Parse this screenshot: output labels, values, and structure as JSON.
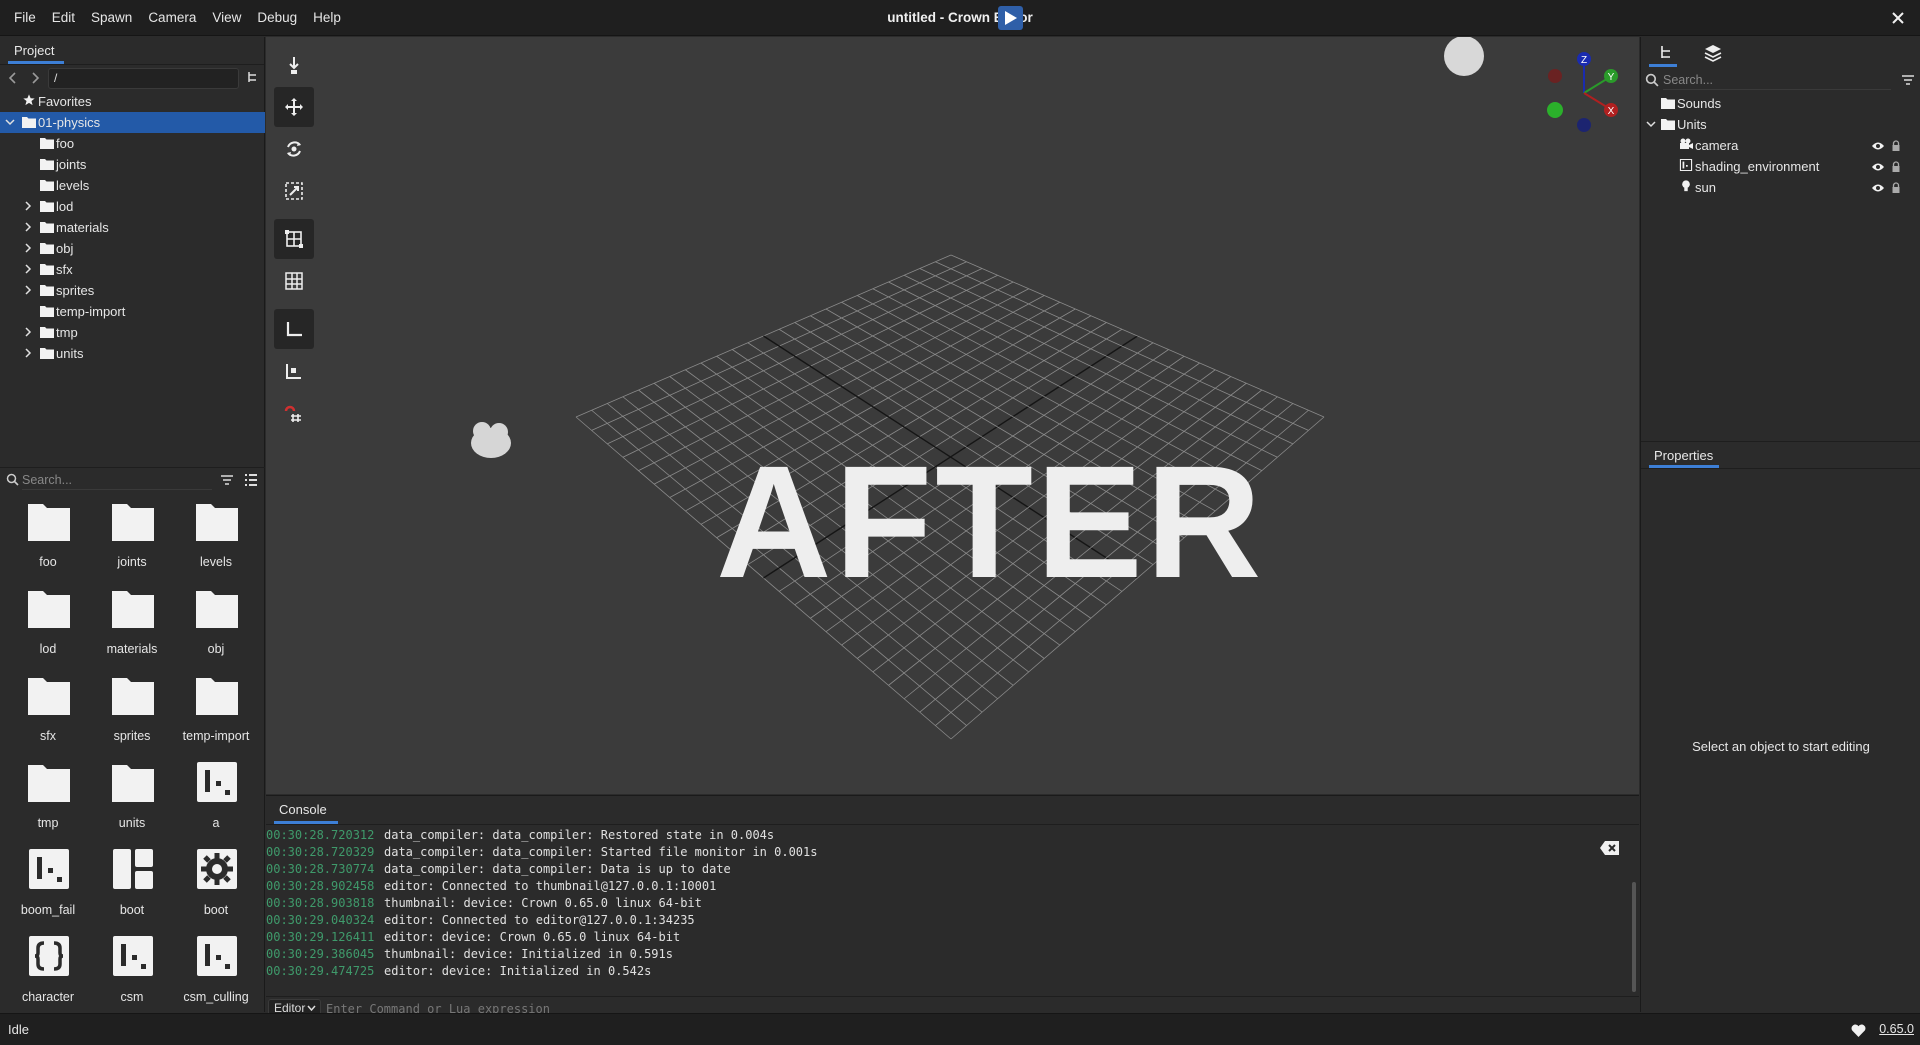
{
  "window": {
    "title": "untitled - Crown Editor",
    "menus": [
      "File",
      "Edit",
      "Spawn",
      "Camera",
      "View",
      "Debug",
      "Help"
    ]
  },
  "project": {
    "tab": "Project",
    "path": "/",
    "tree": [
      {
        "label": "Favorites",
        "icon": "star-icon",
        "depth": 0,
        "expander": "none"
      },
      {
        "label": "01-physics",
        "icon": "folder-icon",
        "depth": 0,
        "expander": "open",
        "selected": true
      },
      {
        "label": "foo",
        "icon": "folder-icon",
        "depth": 1,
        "expander": "none"
      },
      {
        "label": "joints",
        "icon": "folder-icon",
        "depth": 1,
        "expander": "none"
      },
      {
        "label": "levels",
        "icon": "folder-icon",
        "depth": 1,
        "expander": "none"
      },
      {
        "label": "lod",
        "icon": "folder-icon",
        "depth": 1,
        "expander": "closed"
      },
      {
        "label": "materials",
        "icon": "folder-icon",
        "depth": 1,
        "expander": "closed"
      },
      {
        "label": "obj",
        "icon": "folder-icon",
        "depth": 1,
        "expander": "closed"
      },
      {
        "label": "sfx",
        "icon": "folder-icon",
        "depth": 1,
        "expander": "closed"
      },
      {
        "label": "sprites",
        "icon": "folder-icon",
        "depth": 1,
        "expander": "closed"
      },
      {
        "label": "temp-import",
        "icon": "folder-icon",
        "depth": 1,
        "expander": "none"
      },
      {
        "label": "tmp",
        "icon": "folder-icon",
        "depth": 1,
        "expander": "closed"
      },
      {
        "label": "units",
        "icon": "folder-icon",
        "depth": 1,
        "expander": "closed"
      }
    ],
    "search_placeholder": "Search...",
    "items": [
      {
        "label": "foo",
        "icon": "folder-icon"
      },
      {
        "label": "joints",
        "icon": "folder-icon"
      },
      {
        "label": "levels",
        "icon": "folder-icon"
      },
      {
        "label": "lod",
        "icon": "folder-icon"
      },
      {
        "label": "materials",
        "icon": "folder-icon"
      },
      {
        "label": "obj",
        "icon": "folder-icon"
      },
      {
        "label": "sfx",
        "icon": "folder-icon"
      },
      {
        "label": "sprites",
        "icon": "folder-icon"
      },
      {
        "label": "temp-import",
        "icon": "folder-icon"
      },
      {
        "label": "tmp",
        "icon": "folder-icon"
      },
      {
        "label": "units",
        "icon": "folder-icon"
      },
      {
        "label": "a",
        "icon": "unit-icon"
      },
      {
        "label": "boom_fail",
        "icon": "unit-icon"
      },
      {
        "label": "boot",
        "icon": "package-icon"
      },
      {
        "label": "boot",
        "icon": "config-gear-icon"
      },
      {
        "label": "character",
        "icon": "script-braces-icon"
      },
      {
        "label": "csm",
        "icon": "unit-icon"
      },
      {
        "label": "csm_culling",
        "icon": "unit-icon"
      }
    ]
  },
  "viewport": {
    "overlay_text": "AFTER",
    "tools": [
      "place-tool",
      "move-tool",
      "rotate-tool",
      "scale-tool",
      "world-grid-snap",
      "grid-toggle",
      "local-axes",
      "snap-to-grid-axes",
      "snap-magnet-grid"
    ],
    "gizmo_axes": [
      "Z",
      "Y",
      "X"
    ]
  },
  "console": {
    "tab": "Console",
    "lines": [
      {
        "ts": "00:30:28.720312",
        "msg": "data_compiler: data_compiler: Restored state in 0.004s"
      },
      {
        "ts": "00:30:28.720329",
        "msg": "data_compiler: data_compiler: Started file monitor in 0.001s"
      },
      {
        "ts": "00:30:28.730774",
        "msg": "data_compiler: data_compiler: Data is up to date"
      },
      {
        "ts": "00:30:28.902458",
        "msg": "editor: Connected to thumbnail@127.0.0.1:10001"
      },
      {
        "ts": "00:30:28.903818",
        "msg": "thumbnail: device: Crown 0.65.0 linux 64-bit"
      },
      {
        "ts": "00:30:29.040324",
        "msg": "editor: Connected to editor@127.0.0.1:34235"
      },
      {
        "ts": "00:30:29.126411",
        "msg": "editor: device: Crown 0.65.0 linux 64-bit"
      },
      {
        "ts": "00:30:29.386045",
        "msg": "thumbnail: device: Initialized in 0.591s"
      },
      {
        "ts": "00:30:29.474725",
        "msg": "editor: device: Initialized in 0.542s"
      }
    ],
    "target": "Editor",
    "input_placeholder": "Enter Command or Lua expression"
  },
  "level_tree": {
    "search_placeholder": "Search...",
    "items": [
      {
        "label": "Sounds",
        "icon": "folder-icon",
        "depth": 0,
        "expander": "none"
      },
      {
        "label": "Units",
        "icon": "folder-icon",
        "depth": 0,
        "expander": "open"
      },
      {
        "label": "camera",
        "icon": "camera-icon",
        "depth": 1,
        "visibility": true
      },
      {
        "label": "shading_environment",
        "icon": "unit-icon",
        "depth": 1,
        "visibility": true
      },
      {
        "label": "sun",
        "icon": "light-bulb-icon",
        "depth": 1,
        "visibility": true
      }
    ]
  },
  "properties": {
    "tab": "Properties",
    "empty_message": "Select an object to start editing"
  },
  "status": {
    "text": "Idle",
    "version": "0.65.0"
  },
  "colors": {
    "accent": "#3d7fd6",
    "selection": "#235aa8",
    "timestamp": "#3f9a6b"
  }
}
